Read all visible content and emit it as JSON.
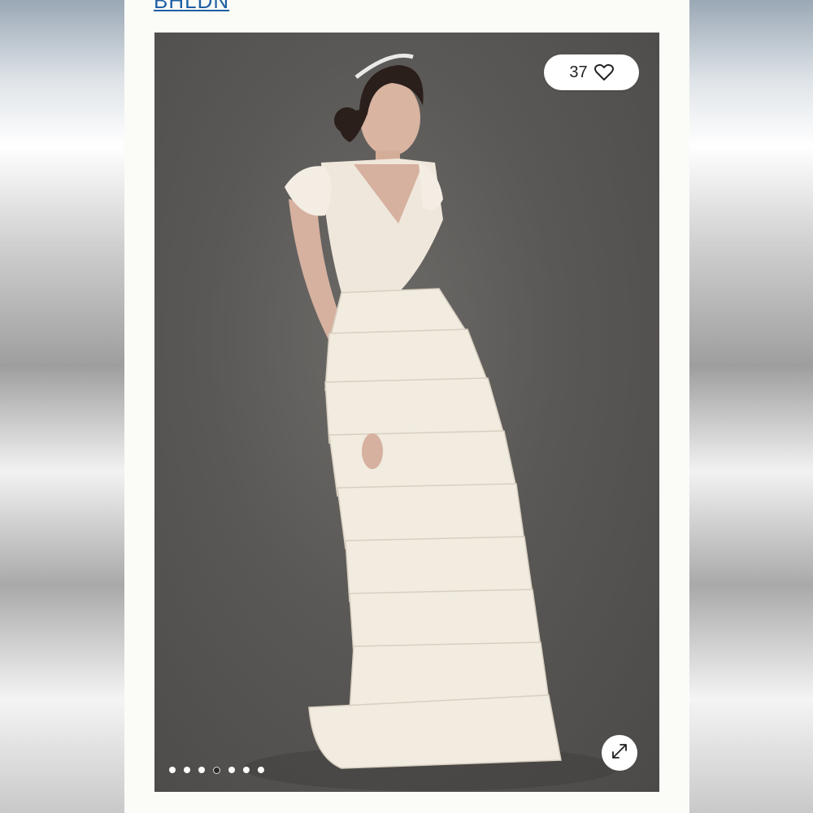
{
  "brand": {
    "link_text": "BHLDN"
  },
  "gallery": {
    "like_count": "37",
    "heart_icon": "heart-outline-icon",
    "expand_icon": "expand-arrows-icon",
    "dots_total": 7,
    "active_dot_index": 3
  },
  "colors": {
    "link": "#1f5fa3",
    "photo_background": "#575552",
    "gown": "#f1ebe0"
  }
}
